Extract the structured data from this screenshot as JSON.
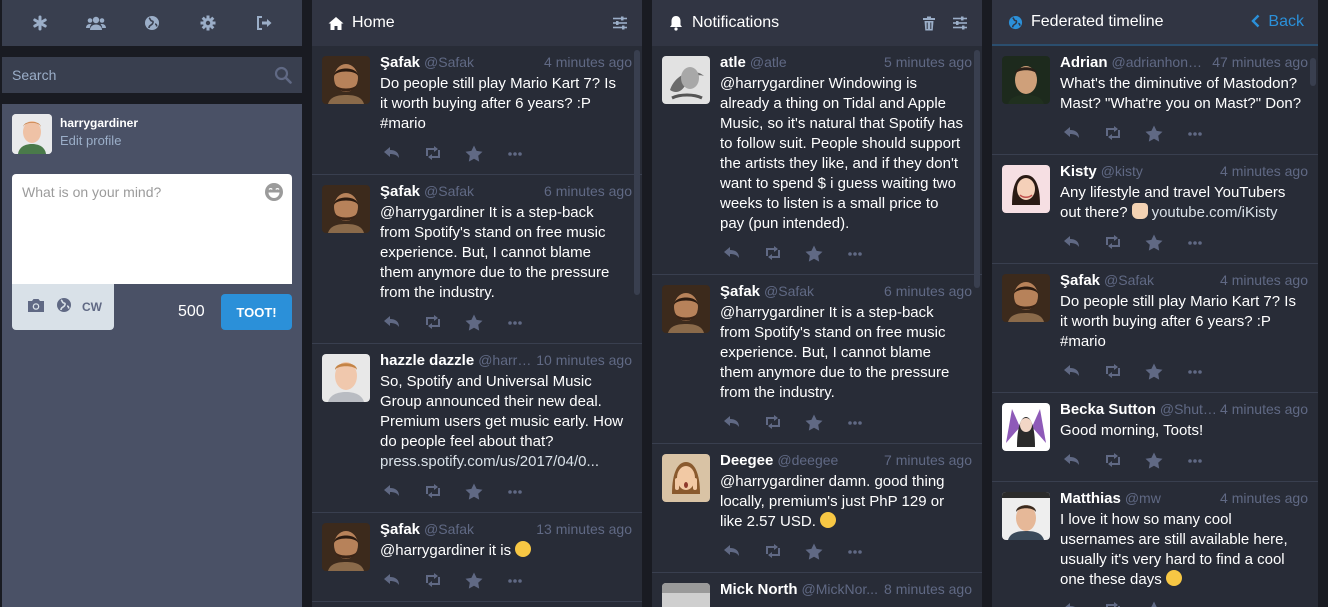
{
  "drawer": {
    "search": {
      "placeholder": "Search"
    },
    "account": {
      "username": "harrygardiner",
      "edit_label": "Edit profile"
    },
    "compose": {
      "placeholder": "What is on your mind?",
      "cw_label": "CW",
      "char_count": "500",
      "toot_label": "TOOT!"
    }
  },
  "columns": {
    "home": {
      "title": "Home",
      "statuses": [
        {
          "name": "Şafak",
          "acct": "@Safak",
          "time": "4 minutes ago",
          "lines": [
            "Do people still play Mario Kart 7? Is",
            "it worth buying after 6 years? :P",
            "#mario"
          ]
        },
        {
          "name": "Şafak",
          "acct": "@Safak",
          "time": "6 minutes ago",
          "lines": [
            "@harrygardiner It is a step-back",
            "from Spotify's stand on free music",
            "experience. But, I cannot blame",
            "them anymore due to the pressure",
            "from the industry."
          ]
        },
        {
          "name": "hazzle dazzle",
          "acct": "@harry...",
          "time": "10 minutes ago",
          "lines": [
            "So, Spotify and Universal Music",
            "Group announced their new deal.",
            "Premium users get music early. How",
            "do people feel about that?"
          ],
          "link": "press.spotify.com/us/2017/04/0..."
        },
        {
          "name": "Şafak",
          "acct": "@Safak",
          "time": "13 minutes ago",
          "lines": [
            "@harrygardiner it is"
          ]
        }
      ]
    },
    "notifications": {
      "title": "Notifications",
      "statuses": [
        {
          "name": "atle",
          "acct": "@atle",
          "time": "5 minutes ago",
          "lines": [
            "@harrygardiner Windowing is",
            "already a thing on Tidal and Apple",
            "Music, so it's natural that Spotify has",
            "to follow suit. People should support",
            "the artists they like, and if they don't",
            "want to spend $ i guess waiting two",
            "weeks to listen is a small price to",
            "pay (pun intended)."
          ]
        },
        {
          "name": "Şafak",
          "acct": "@Safak",
          "time": "6 minutes ago",
          "lines": [
            "@harrygardiner It is a step-back",
            "from Spotify's stand on free music",
            "experience. But, I cannot blame",
            "them anymore due to the pressure",
            "from the industry."
          ]
        },
        {
          "name": "Deegee",
          "acct": "@deegee",
          "time": "7 minutes ago",
          "lines": [
            "@harrygardiner damn. good thing",
            "locally, premium's just PhP 129 or",
            "like 2.57 USD."
          ]
        },
        {
          "name": "Mick North",
          "acct": "@MickNor...",
          "time": "8 minutes ago",
          "lines": []
        }
      ]
    },
    "federated": {
      "title": "Federated timeline",
      "back_label": "Back",
      "statuses": [
        {
          "name": "Adrian",
          "acct": "@adrianhon@...",
          "time": "47 minutes ago",
          "lines": [
            "What's the diminutive of Mastodon?",
            "Mast? \"What're you on Mast?\" Don?"
          ]
        },
        {
          "name": "Kisty",
          "acct": "@kisty",
          "time": "4 minutes ago",
          "lines": [
            "Any lifestyle and travel YouTubers",
            "out there?"
          ],
          "link": "youtube.com/iKisty"
        },
        {
          "name": "Şafak",
          "acct": "@Safak",
          "time": "4 minutes ago",
          "lines": [
            "Do people still play Mario Kart 7? Is",
            "it worth buying after 6 years? :P",
            "#mario"
          ]
        },
        {
          "name": "Becka Sutton",
          "acct": "@Shutsu...",
          "time": "4 minutes ago",
          "lines": [
            "Good morning, Toots!"
          ]
        },
        {
          "name": "Matthias",
          "acct": "@mw",
          "time": "4 minutes ago",
          "lines": [
            "I love it how so many cool",
            "usernames are still available here,",
            "usually it's very hard to find a cool",
            "one these days"
          ]
        }
      ]
    }
  },
  "colors": {
    "accent": "#2b90d9",
    "column_bg": "#282c37",
    "header_bg": "#313543",
    "muted": "#606984"
  }
}
